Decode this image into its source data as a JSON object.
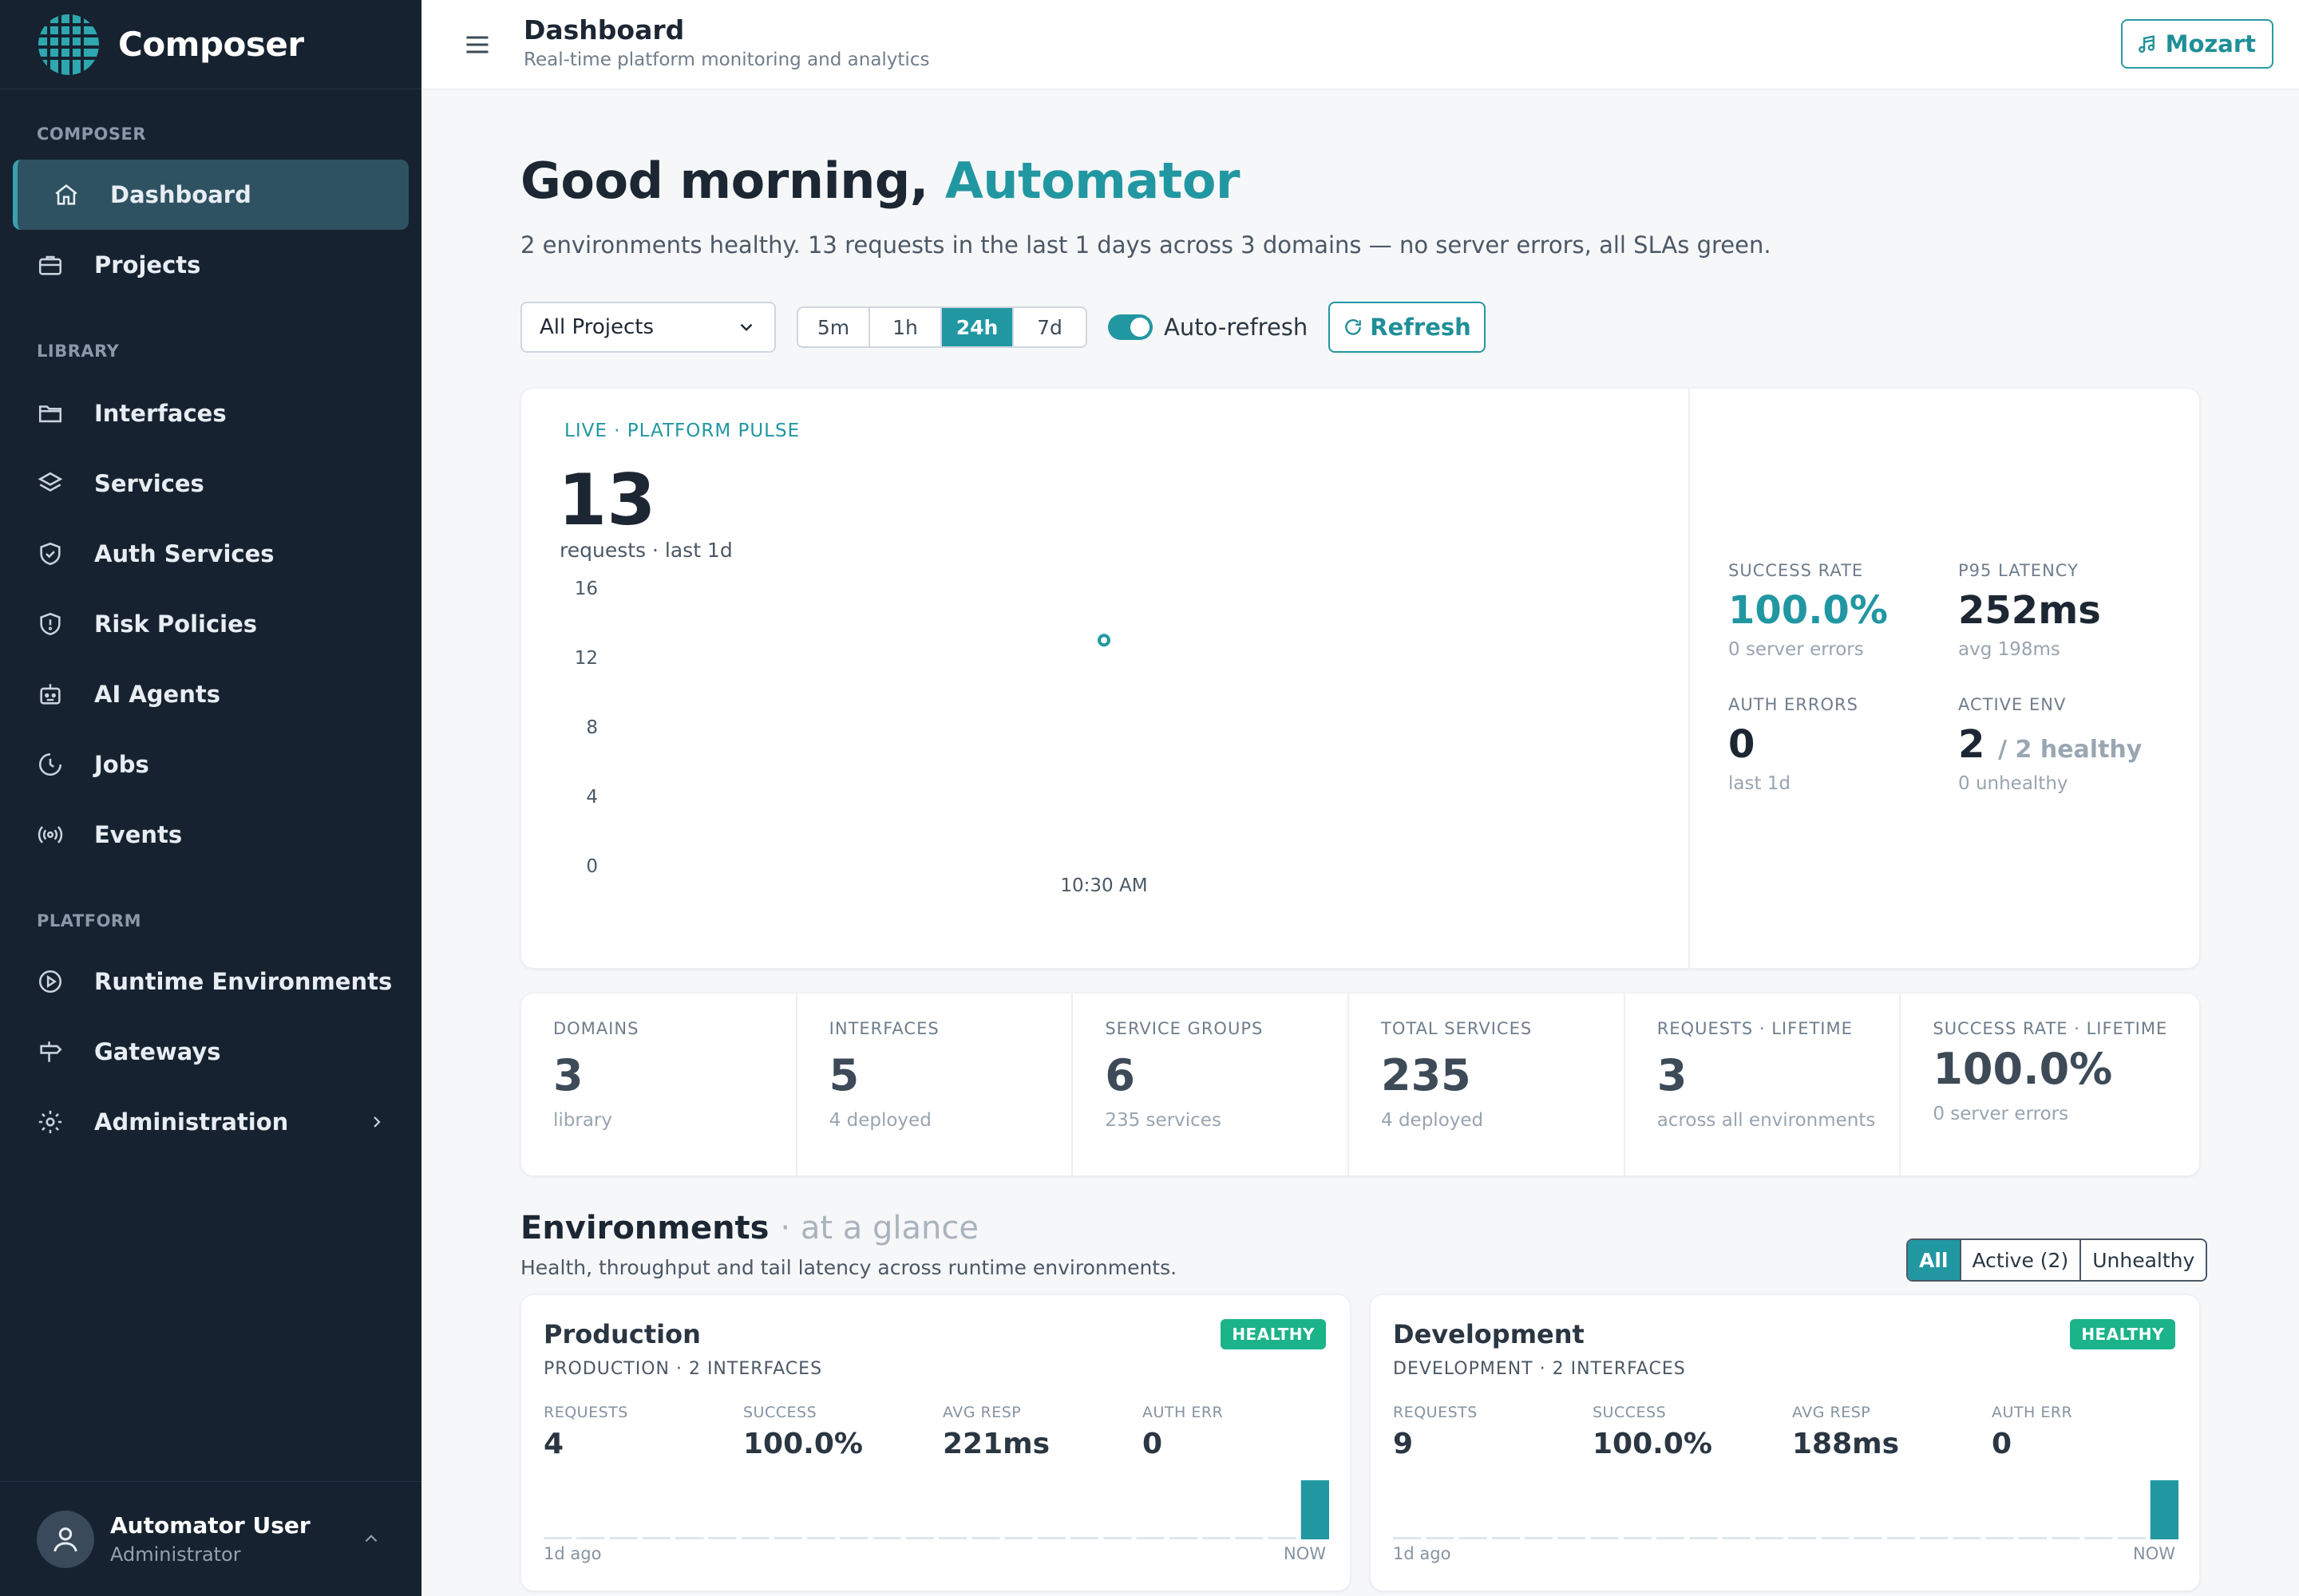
{
  "app": {
    "name": "Composer"
  },
  "sidebar": {
    "sections": [
      {
        "title": "COMPOSER",
        "items": [
          {
            "label": "Dashboard",
            "icon": "home-icon",
            "active": true
          },
          {
            "label": "Projects",
            "icon": "briefcase-icon"
          }
        ]
      },
      {
        "title": "LIBRARY",
        "items": [
          {
            "label": "Interfaces",
            "icon": "folder-icon"
          },
          {
            "label": "Services",
            "icon": "layers-icon"
          },
          {
            "label": "Auth Services",
            "icon": "shield-check-icon"
          },
          {
            "label": "Risk Policies",
            "icon": "shield-alert-icon"
          },
          {
            "label": "AI Agents",
            "icon": "robot-icon"
          },
          {
            "label": "Jobs",
            "icon": "clock-icon"
          },
          {
            "label": "Events",
            "icon": "broadcast-icon"
          }
        ]
      },
      {
        "title": "PLATFORM",
        "items": [
          {
            "label": "Runtime Environments",
            "icon": "play-circle-icon"
          },
          {
            "label": "Gateways",
            "icon": "signpost-icon"
          },
          {
            "label": "Administration",
            "icon": "gear-icon"
          }
        ]
      }
    ],
    "user": {
      "name": "Automator User",
      "role": "Administrator"
    }
  },
  "topbar": {
    "title": "Dashboard",
    "subtitle": "Real-time platform monitoring and analytics",
    "user_button": "Mozart"
  },
  "greeting": {
    "prefix": "Good morning,",
    "name": "Automator"
  },
  "summary": "2 environments healthy. 13 requests in the last 1 days across 3 domains — no server errors, all SLAs green.",
  "controls": {
    "project_select": "All Projects",
    "ranges": [
      "5m",
      "1h",
      "24h",
      "7d"
    ],
    "selected_range": "24h",
    "auto_refresh_label": "Auto-refresh",
    "auto_refresh_on": true,
    "refresh_label": "Refresh"
  },
  "pulse": {
    "label": "LIVE · PLATFORM PULSE",
    "value": "13",
    "sub": "requests · last 1d"
  },
  "chart_data": {
    "type": "line",
    "title": "",
    "x": [
      "10:30 AM"
    ],
    "series": [
      {
        "values": [
          13
        ]
      }
    ],
    "y_ticks": [
      16,
      12,
      8,
      4,
      0
    ],
    "ylim": [
      0,
      16
    ],
    "grid": false
  },
  "side_stats": [
    {
      "label": "SUCCESS RATE",
      "value": "100.0%",
      "note": "0 server errors",
      "accent": true
    },
    {
      "label": "P95 LATENCY",
      "value": "252ms",
      "note": "avg 198ms"
    },
    {
      "label": "AUTH ERRORS",
      "value": "0",
      "note": "last 1d"
    },
    {
      "label": "ACTIVE ENV",
      "value": "2",
      "value_suffix": "/ 2 healthy",
      "note": "0 unhealthy"
    }
  ],
  "metrics": [
    {
      "label": "DOMAINS",
      "value": "3",
      "note": "library"
    },
    {
      "label": "INTERFACES",
      "value": "5",
      "note": "4 deployed"
    },
    {
      "label": "SERVICE GROUPS",
      "value": "6",
      "note": "235 services"
    },
    {
      "label": "TOTAL SERVICES",
      "value": "235",
      "note": "4 deployed"
    },
    {
      "label": "REQUESTS · LIFETIME",
      "value": "3",
      "note": "across all environments"
    },
    {
      "label": "SUCCESS RATE · LIFETIME",
      "value": "100.0%",
      "note": "0 server errors"
    }
  ],
  "environments": {
    "title": "Environments",
    "title_suffix": "· at a glance",
    "subtitle": "Health, throughput and tail latency across runtime environments.",
    "filters": [
      "All",
      "Active (2)",
      "Unhealthy"
    ],
    "selected_filter": "All",
    "cards": [
      {
        "name": "Production",
        "meta": "PRODUCTION · 2 INTERFACES",
        "status": "HEALTHY",
        "stats": [
          {
            "label": "REQUESTS",
            "value": "4"
          },
          {
            "label": "SUCCESS",
            "value": "100.0%"
          },
          {
            "label": "AVG RESP",
            "value": "221ms"
          },
          {
            "label": "AUTH ERR",
            "value": "0"
          }
        ],
        "spark_start": "1d ago",
        "spark_end": "NOW",
        "spark": [
          0,
          0,
          0,
          0,
          0,
          0,
          0,
          0,
          0,
          0,
          0,
          0,
          0,
          0,
          0,
          0,
          0,
          0,
          0,
          0,
          0,
          0,
          0,
          1
        ]
      },
      {
        "name": "Development",
        "meta": "DEVELOPMENT · 2 INTERFACES",
        "status": "HEALTHY",
        "stats": [
          {
            "label": "REQUESTS",
            "value": "9"
          },
          {
            "label": "SUCCESS",
            "value": "100.0%"
          },
          {
            "label": "AVG RESP",
            "value": "188ms"
          },
          {
            "label": "AUTH ERR",
            "value": "0"
          }
        ],
        "spark_start": "1d ago",
        "spark_end": "NOW",
        "spark": [
          0,
          0,
          0,
          0,
          0,
          0,
          0,
          0,
          0,
          0,
          0,
          0,
          0,
          0,
          0,
          0,
          0,
          0,
          0,
          0,
          0,
          0,
          0,
          1
        ]
      }
    ]
  },
  "colors": {
    "accent": "#2197a2",
    "sidebar_bg": "#16222f",
    "healthy": "#1bb38a"
  }
}
